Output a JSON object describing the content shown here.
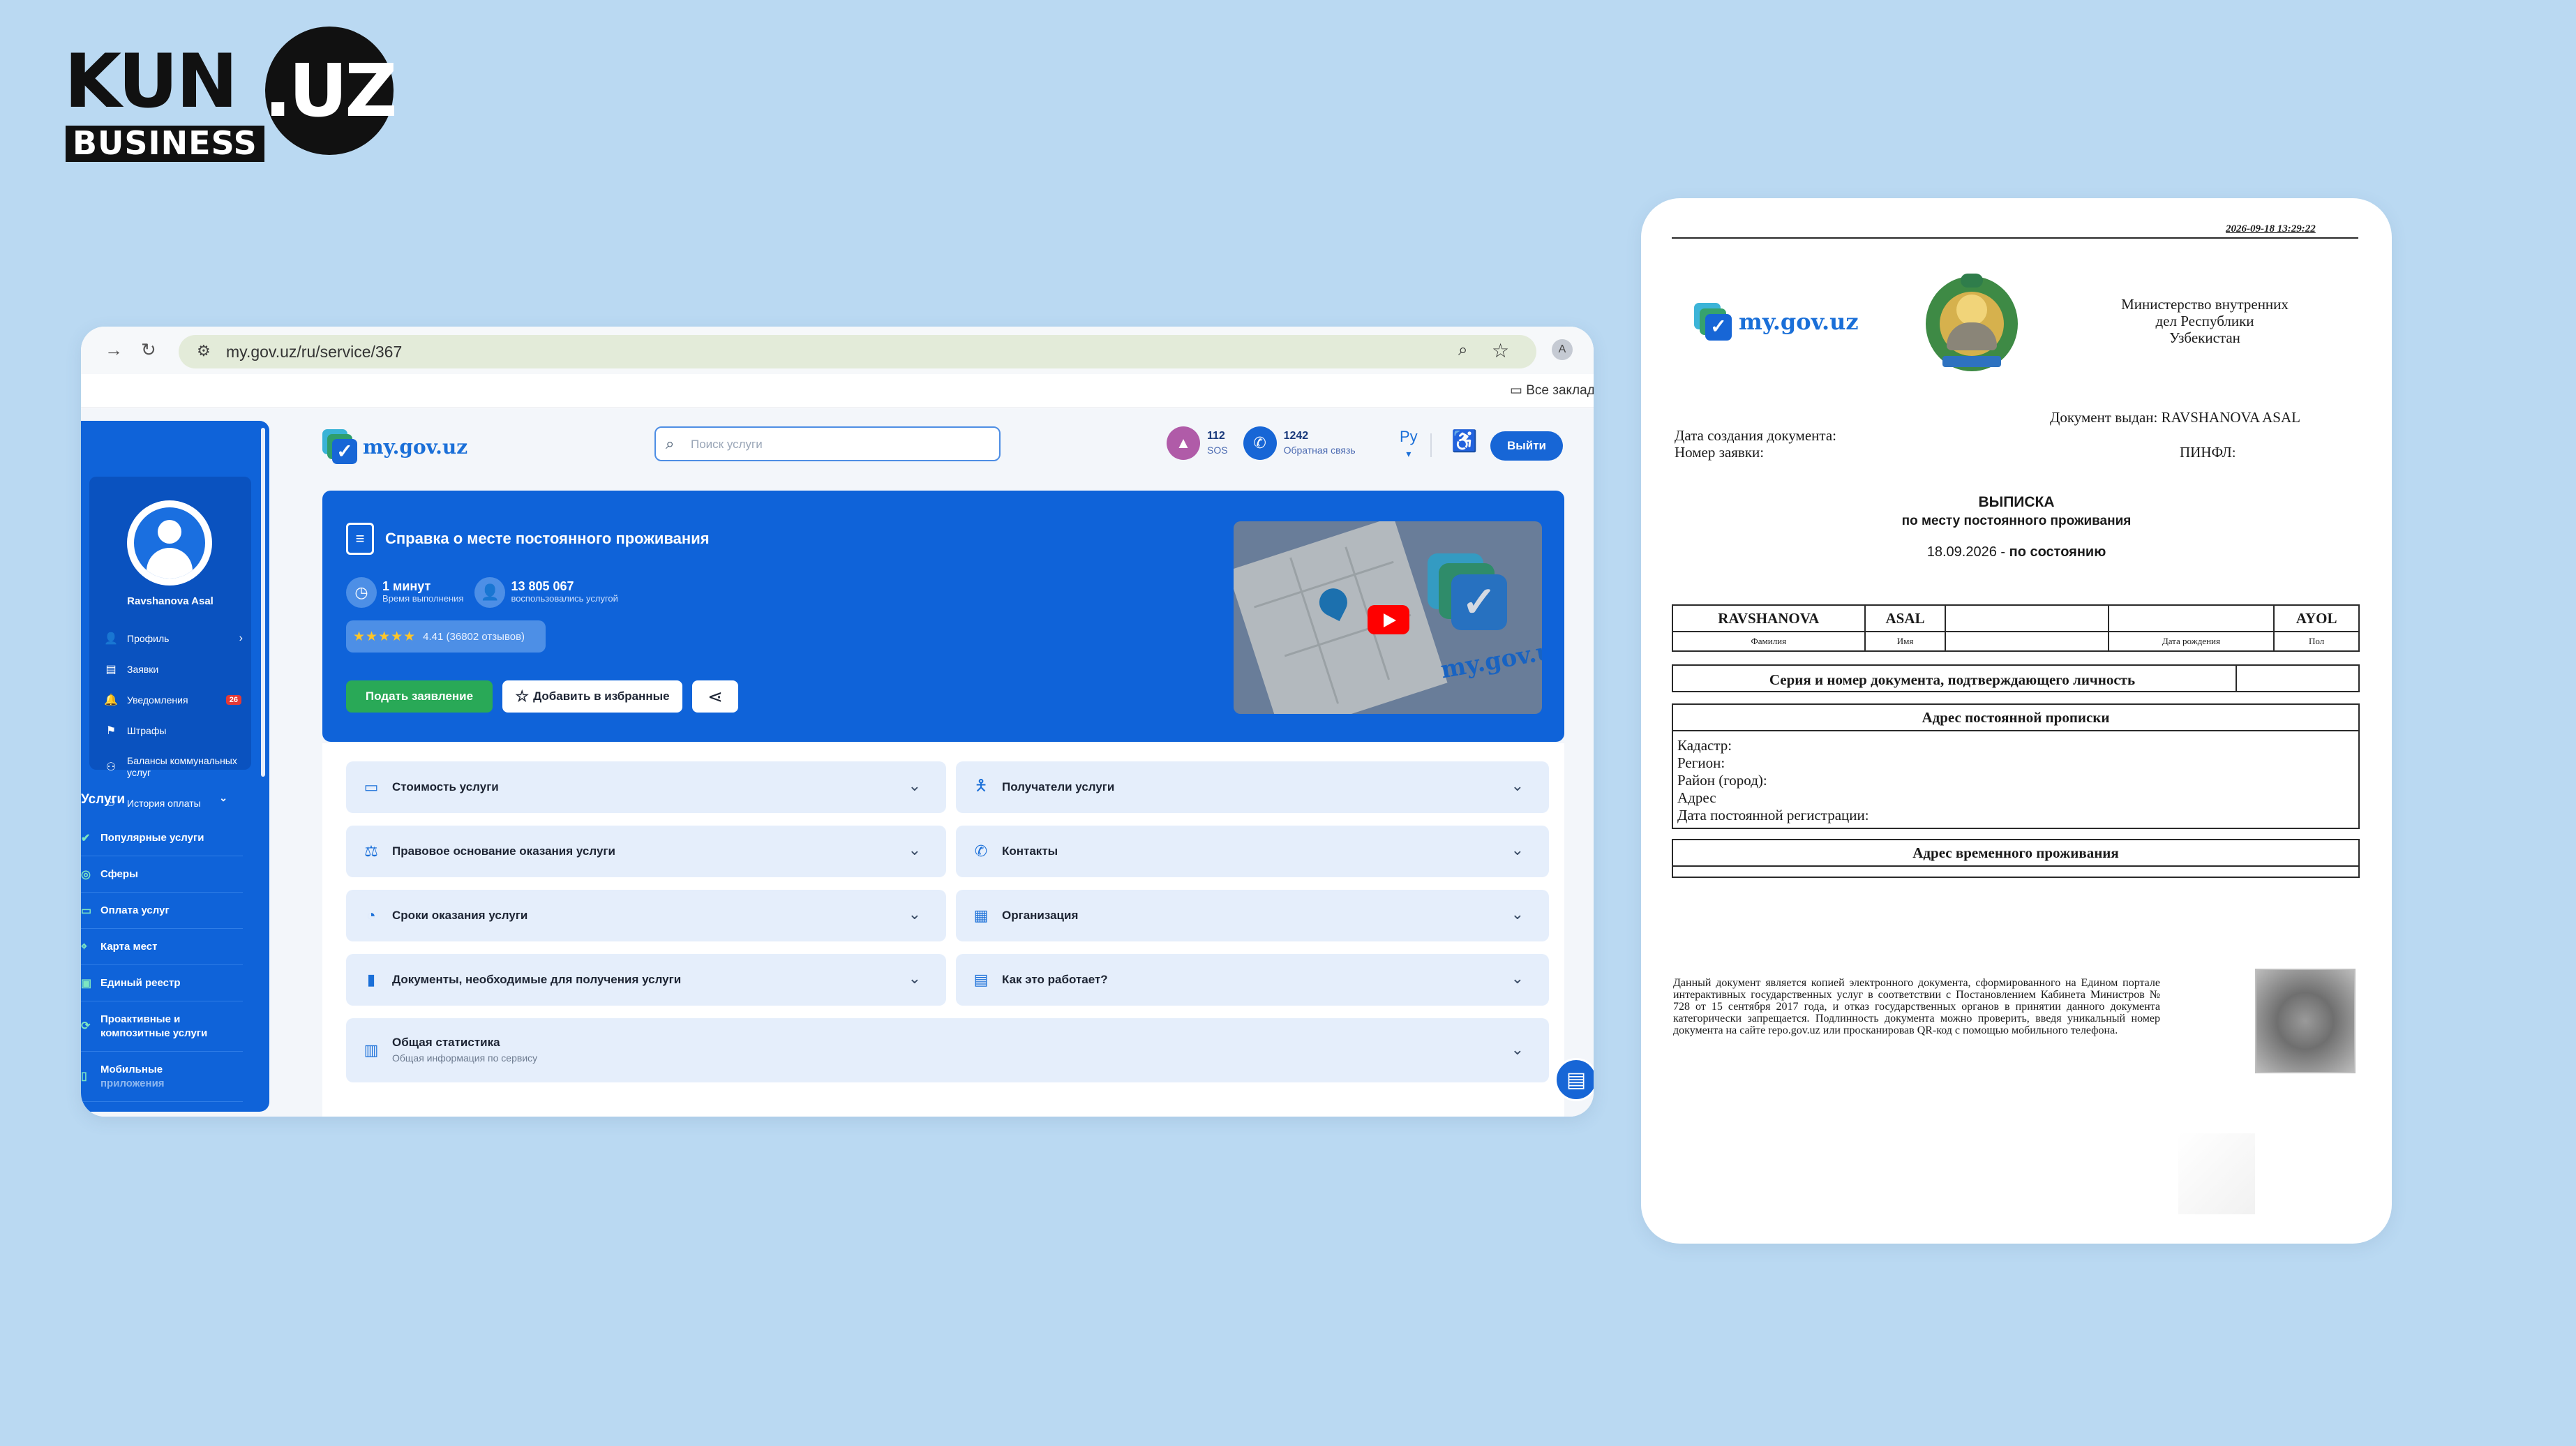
{
  "brand": {
    "name": "KUN",
    "uz": ".UZ",
    "sub": "BUSINESS"
  },
  "browser": {
    "url": "my.gov.uz/ru/service/367",
    "bookmarks_label": "Все заклад"
  },
  "header": {
    "logo_text": "my.gov.uz",
    "search_placeholder": "Поиск услуги",
    "sos_number": "112",
    "sos_label": "SOS",
    "feedback_number": "1242",
    "feedback_label": "Обратная связь",
    "lang": "Ру",
    "exit_label": "Выйти"
  },
  "sidebar": {
    "user_name": "Ravshanova Asal",
    "items": [
      {
        "label": "Профиль",
        "icon": "user-icon"
      },
      {
        "label": "Заявки",
        "icon": "document-icon"
      },
      {
        "label": "Уведомления",
        "icon": "bell-icon",
        "badge": "26"
      },
      {
        "label": "Штрафы",
        "icon": "flag-icon"
      },
      {
        "label": "Балансы коммунальных услуг",
        "icon": "utilities-icon"
      },
      {
        "label": "История оплаты",
        "icon": "history-icon"
      }
    ],
    "services_title": "Услуги",
    "services": [
      {
        "label": "Популярные услуги"
      },
      {
        "label": "Сферы"
      },
      {
        "label": "Оплата услуг"
      },
      {
        "label": "Карта мест"
      },
      {
        "label": "Единый реестр"
      },
      {
        "label": "Проактивные и композитные услуги"
      },
      {
        "label": "Мобильные",
        "sub": "приложения"
      }
    ]
  },
  "hero": {
    "title": "Справка о месте постоянного проживания",
    "stat1_value": "1 минут",
    "stat1_label": "Время выполнения",
    "stat2_value": "13 805 067",
    "stat2_label": "воспользовались услугой",
    "stars": "★★★★★",
    "rating": "4.41 (36802 отзывов)",
    "apply_label": "Подать заявление",
    "favorite_label": "Добавить в избранные"
  },
  "accordions": {
    "left": [
      {
        "label": "Стоимость услуги",
        "icon": "card-icon"
      },
      {
        "label": "Правовое основание оказания услуги",
        "icon": "scales-icon"
      },
      {
        "label": "Сроки оказания услуги",
        "icon": "clock-icon"
      },
      {
        "label": "Документы, необходимые для получения услуги",
        "icon": "file-icon"
      }
    ],
    "right": [
      {
        "label": "Получатели услуги",
        "icon": "person-icon"
      },
      {
        "label": "Контакты",
        "icon": "phone-icon"
      },
      {
        "label": "Организация",
        "icon": "building-icon"
      },
      {
        "label": "Как это работает?",
        "icon": "chat-icon"
      }
    ],
    "stats_title": "Общая статистика",
    "stats_sub": "Общая информация по сервису"
  },
  "document": {
    "timestamp": "2026-09-18 13:29:22",
    "logo_text": "my.gov.uz",
    "ministry": [
      "Министерство внутренних",
      "дел Республики",
      "Узбекистан"
    ],
    "issued_to": "Документ выдан: RAVSHANOVA ASAL",
    "created_label": "Дата создания документа:",
    "request_label": "Номер заявки:",
    "pinfl_label": "ПИНФЛ:",
    "title": "ВЫПИСКА",
    "subtitle": "по месту постоянного проживания",
    "date": "18.09.2026",
    "date_suffix": "по состоянию",
    "surname": "RAVSHANOVA",
    "first_name": "ASAL",
    "gender": "AYOL",
    "lbl_surname": "Фамилия",
    "lbl_name": "Имя",
    "lbl_birth": "Дата рождения",
    "lbl_gender": "Пол",
    "id_doc_label": "Серия и номер документа, подтверждающего личность",
    "perm_address_title": "Адрес постоянной прописки",
    "perm_fields": [
      "Кадастр:",
      "Регион:",
      "Район (город):",
      "Адрес",
      "Дата постоянной регистрации:"
    ],
    "temp_address_title": "Адрес временного проживания",
    "footer": "Данный документ является копией электронного документа, сформированного на Едином портале интерактивных государственных услуг в соответствии с Постановлением Кабинета Министров № 728 от 15 сентября 2017 года, и отказ государственных органов в принятии данного документа категорически запрещается. Подлинность документа можно проверить, введя уникальный номер документа на сайте repo.gov.uz или просканировав QR-код с помощью мобильного телефона."
  },
  "colors": {
    "background": "#bad9f2",
    "primary": "#1766d6",
    "sidebar": "#0f63d9",
    "apply_button": "#29a957",
    "badge": "#e53935"
  }
}
